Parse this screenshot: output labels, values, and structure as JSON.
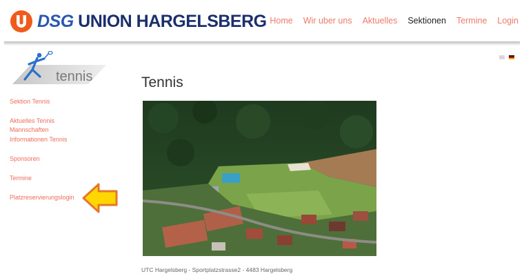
{
  "brand": {
    "prefix": "DSG",
    "name": "UNION HARGELSBERG"
  },
  "nav": [
    {
      "label": "Home"
    },
    {
      "label": "Wir uber uns"
    },
    {
      "label": "Aktuelles"
    },
    {
      "label": "Sektionen",
      "active": true
    },
    {
      "label": "Termine"
    },
    {
      "label": "Login"
    }
  ],
  "section_logo": {
    "label": "tennis"
  },
  "sidebar": {
    "items": [
      {
        "label": "Sektion Tennis"
      },
      {
        "label": "Aktuelles Tennis"
      },
      {
        "label": "Mannschaften"
      },
      {
        "label": "Informationen Tennis"
      },
      {
        "label": "Sponsoren"
      },
      {
        "label": "Termine"
      },
      {
        "label": "Platzreservierungslogin"
      }
    ]
  },
  "main": {
    "title": "Tennis",
    "caption": "UTC Hargelsberg - Sportplatzstrasse2 - 4483 Hargelsberg"
  },
  "colors": {
    "link": "#ee6b5a",
    "nav_link": "#ee7a6a",
    "brand_blue": "#1b2f6e",
    "brand_orange": "#f05a1a",
    "arrow_fill": "#ffd700",
    "arrow_outline": "#e6762a"
  },
  "icons": {
    "brand_logo": "union-u-logo",
    "section_logo": "tennis-player-logo",
    "pointer": "yellow-arrow-left-icon",
    "lang1": "flag-en-icon",
    "lang2": "flag-de-icon"
  }
}
